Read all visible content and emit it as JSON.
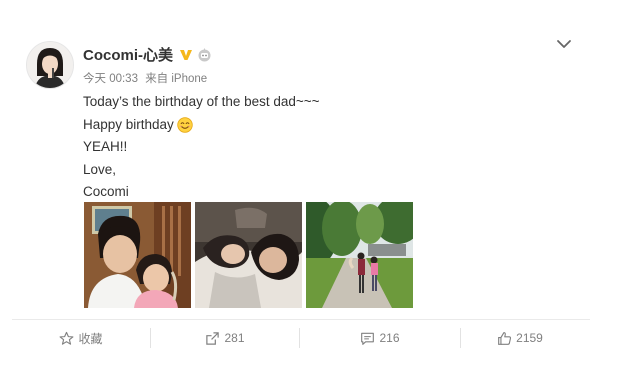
{
  "user": {
    "name": "Cocomi-心美",
    "verified_icon": "verified-v-icon",
    "member_icon": "robot-icon"
  },
  "meta": {
    "time": "今天 00:33",
    "source": "来自 iPhone"
  },
  "post": {
    "lines": [
      "Today’s the birthday of the best dad~~~",
      "Happy birthday",
      "YEAH!!",
      "Love,",
      "Cocomi"
    ],
    "emoji": "smile-emoji"
  },
  "photos": [
    {
      "name": "photo-father-daughter-indoor"
    },
    {
      "name": "photo-sleeping-together"
    },
    {
      "name": "photo-walking-in-park"
    }
  ],
  "actions": {
    "favorite_label": "收藏",
    "repost_count": "281",
    "comment_count": "216",
    "like_count": "2159"
  },
  "colors": {
    "text_primary": "#333333",
    "text_secondary": "#808080",
    "verified_gold": "#f5b71b",
    "divider": "#eaeaea"
  }
}
